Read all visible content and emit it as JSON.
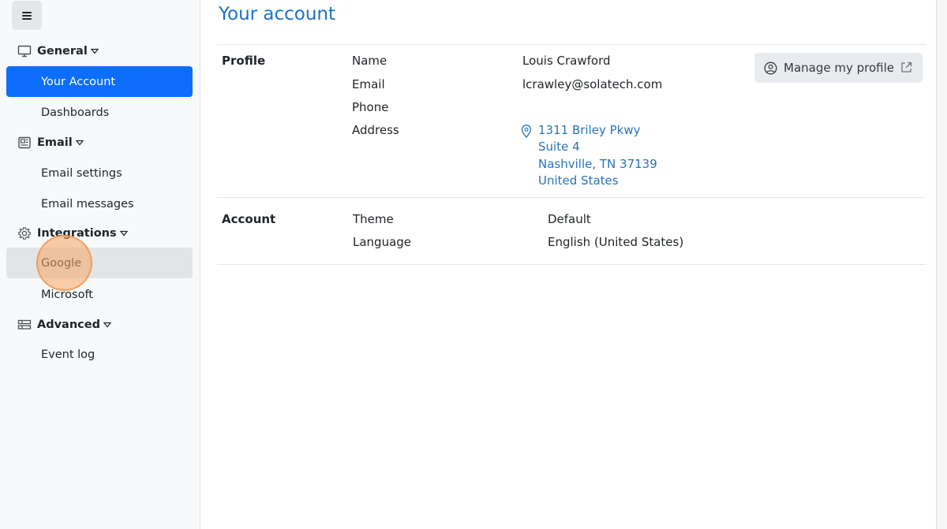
{
  "sidebar": {
    "groups": [
      {
        "label": "General",
        "icon": "monitor-icon",
        "items": [
          {
            "label": "Your Account",
            "state": "active"
          },
          {
            "label": "Dashboards"
          }
        ]
      },
      {
        "label": "Email",
        "icon": "newspaper-icon",
        "items": [
          {
            "label": "Email settings"
          },
          {
            "label": "Email messages"
          }
        ]
      },
      {
        "label": "Integrations",
        "icon": "gear-icon",
        "items": [
          {
            "label": "Google",
            "state": "hover"
          },
          {
            "label": "Microsoft"
          }
        ]
      },
      {
        "label": "Advanced",
        "icon": "table-icon",
        "items": [
          {
            "label": "Event log"
          }
        ]
      }
    ]
  },
  "main": {
    "title": "Your account",
    "profile": {
      "section_label": "Profile",
      "name_label": "Name",
      "name_value": "Louis Crawford",
      "email_label": "Email",
      "email_value": "lcrawley@solatech.com",
      "phone_label": "Phone",
      "phone_value": "",
      "address_label": "Address",
      "address_lines": [
        "1311 Briley Pkwy",
        "Suite 4",
        "Nashville, TN 37139",
        "United States"
      ],
      "manage_button": "Manage my profile"
    },
    "account": {
      "section_label": "Account",
      "theme_label": "Theme",
      "theme_value": "Default",
      "language_label": "Language",
      "language_value": "English (United States)"
    }
  },
  "colors": {
    "accent": "#0d6efd",
    "title": "#1a73c8",
    "link": "#2a73b8"
  }
}
